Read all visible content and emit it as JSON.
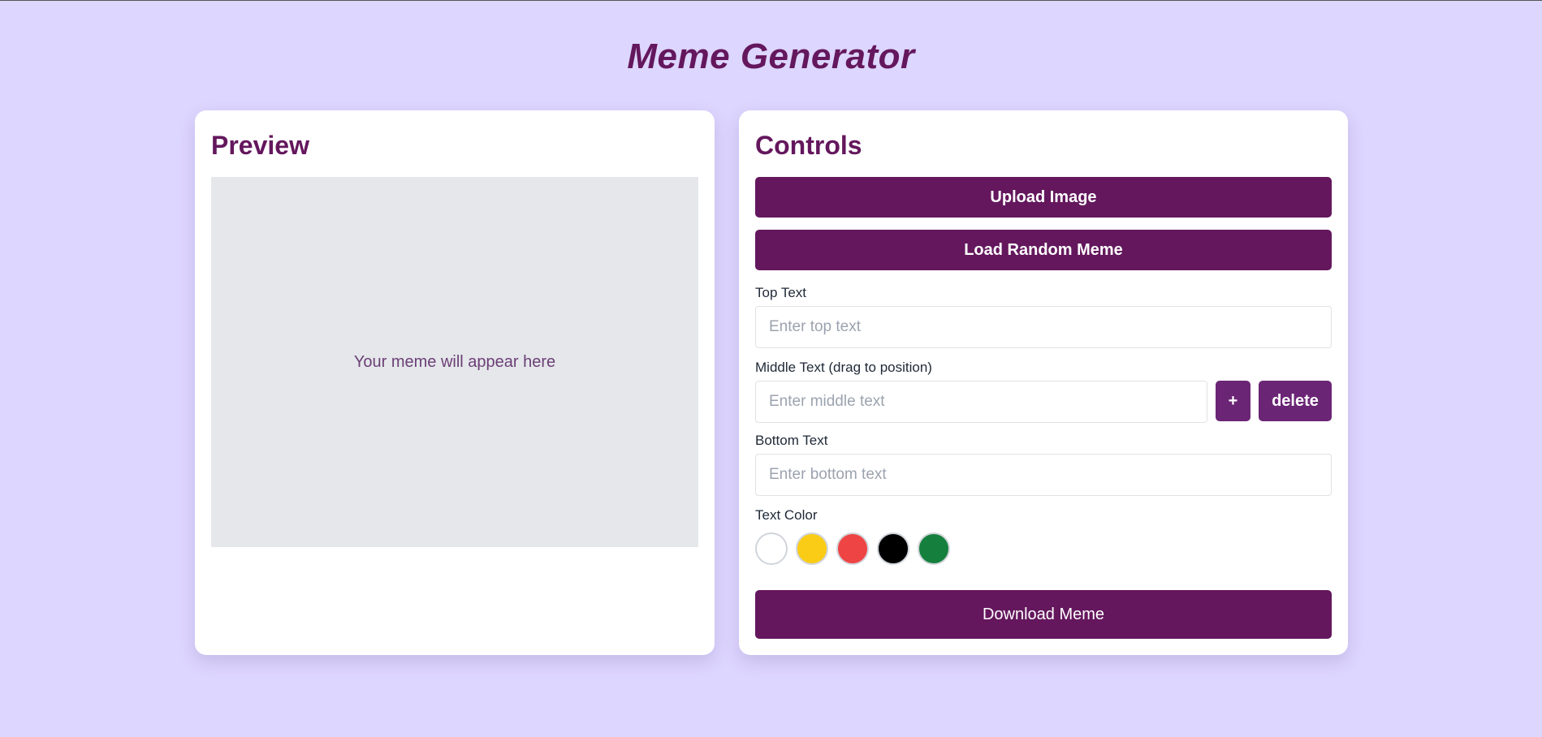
{
  "app": {
    "title": "Meme Generator"
  },
  "preview": {
    "heading": "Preview",
    "placeholder": "Your meme will appear here"
  },
  "controls": {
    "heading": "Controls",
    "upload_label": "Upload Image",
    "random_label": "Load Random Meme",
    "top_text": {
      "label": "Top Text",
      "placeholder": "Enter top text",
      "value": ""
    },
    "middle_text": {
      "label": "Middle Text (drag to position)",
      "placeholder": "Enter middle text",
      "value": "",
      "add_label": "+",
      "delete_label": "delete"
    },
    "bottom_text": {
      "label": "Bottom Text",
      "placeholder": "Enter bottom text",
      "value": ""
    },
    "color_label": "Text Color",
    "colors": [
      {
        "name": "white",
        "hex": "#ffffff"
      },
      {
        "name": "yellow",
        "hex": "#facc15"
      },
      {
        "name": "red",
        "hex": "#ef4444"
      },
      {
        "name": "black",
        "hex": "#000000"
      },
      {
        "name": "green",
        "hex": "#15803d"
      }
    ],
    "download_label": "Download Meme"
  },
  "theme": {
    "background": "#ddd6fe",
    "accent": "#64175d",
    "preview_bg": "#e5e7eb"
  }
}
